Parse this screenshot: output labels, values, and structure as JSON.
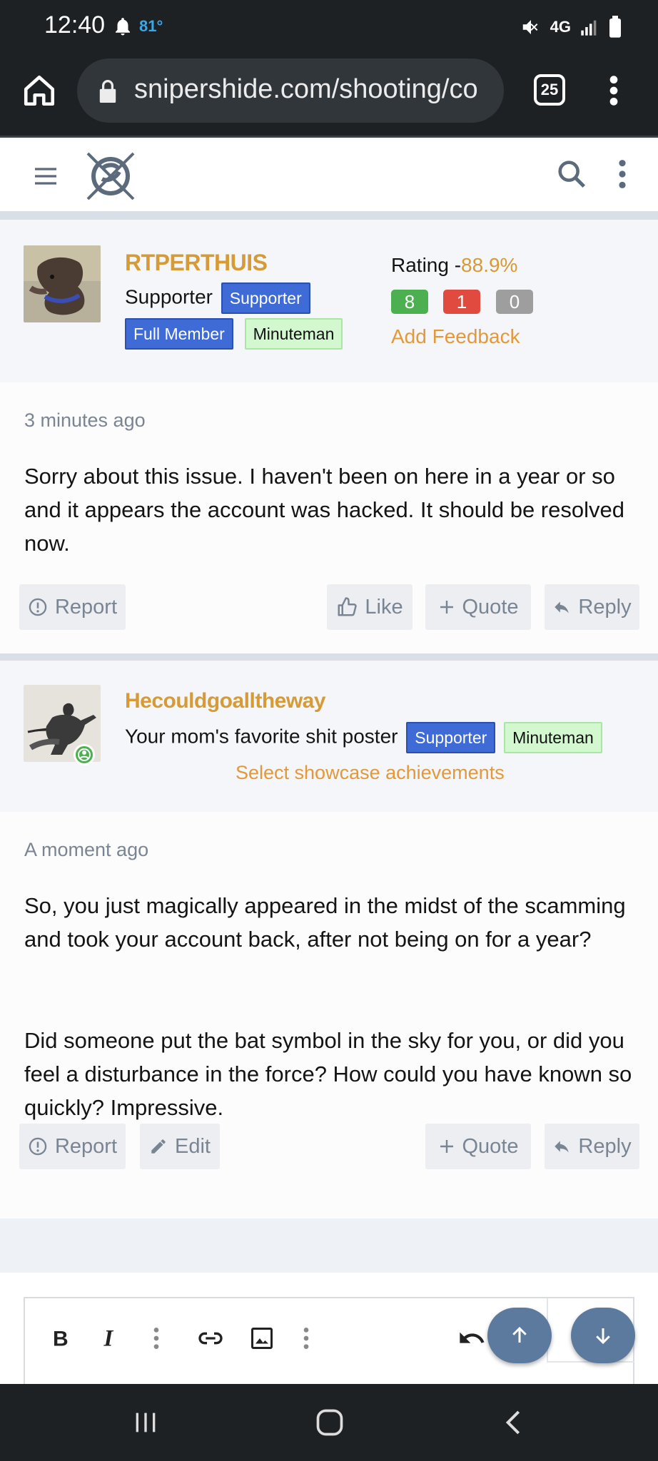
{
  "status_bar": {
    "time": "12:40",
    "temperature": "81°",
    "network": "4G"
  },
  "browser": {
    "url": "snipershide.com/shooting/co",
    "tab_count": "25"
  },
  "posts": [
    {
      "username": "RTPERTHUIS",
      "user_title": "Supporter",
      "badges": [
        "Supporter",
        "Full Member",
        "Minuteman"
      ],
      "rating_label": "Rating -",
      "rating_pct": "88.9%",
      "feedback": {
        "positive": "8",
        "negative": "1",
        "neutral": "0"
      },
      "add_feedback": "Add Feedback",
      "timestamp": "3 minutes ago",
      "message": "Sorry about this issue. I haven't been on here in a year or so and it appears the account was hacked. It should be resolved now.",
      "actions": {
        "report": "Report",
        "like": "Like",
        "quote": "Quote",
        "reply": "Reply"
      }
    },
    {
      "username": "Hecouldgoalltheway",
      "user_title": "Your mom's favorite shit poster",
      "badges": [
        "Supporter",
        "Minuteman"
      ],
      "showcase": "Select showcase achievements",
      "timestamp": "A moment ago",
      "message_p1": "So, you just magically appeared in the midst of the scamming and took your account back, after not being on for a year?",
      "message_p2": "Did someone put the bat symbol in the sky for you, or did you feel a disturbance in the force? How could you have known so quickly? Impressive.",
      "actions": {
        "report": "Report",
        "edit": "Edit",
        "quote": "Quote",
        "reply": "Reply"
      }
    }
  ],
  "colors": {
    "username": "#d69a36",
    "badge_blue": "#3f6bd6",
    "badge_green": "#d3f7cf",
    "feedback_pos": "#4caf50",
    "feedback_neg": "#e04a3f",
    "feedback_neu": "#9e9e9e",
    "fab": "#5c7a9e"
  }
}
